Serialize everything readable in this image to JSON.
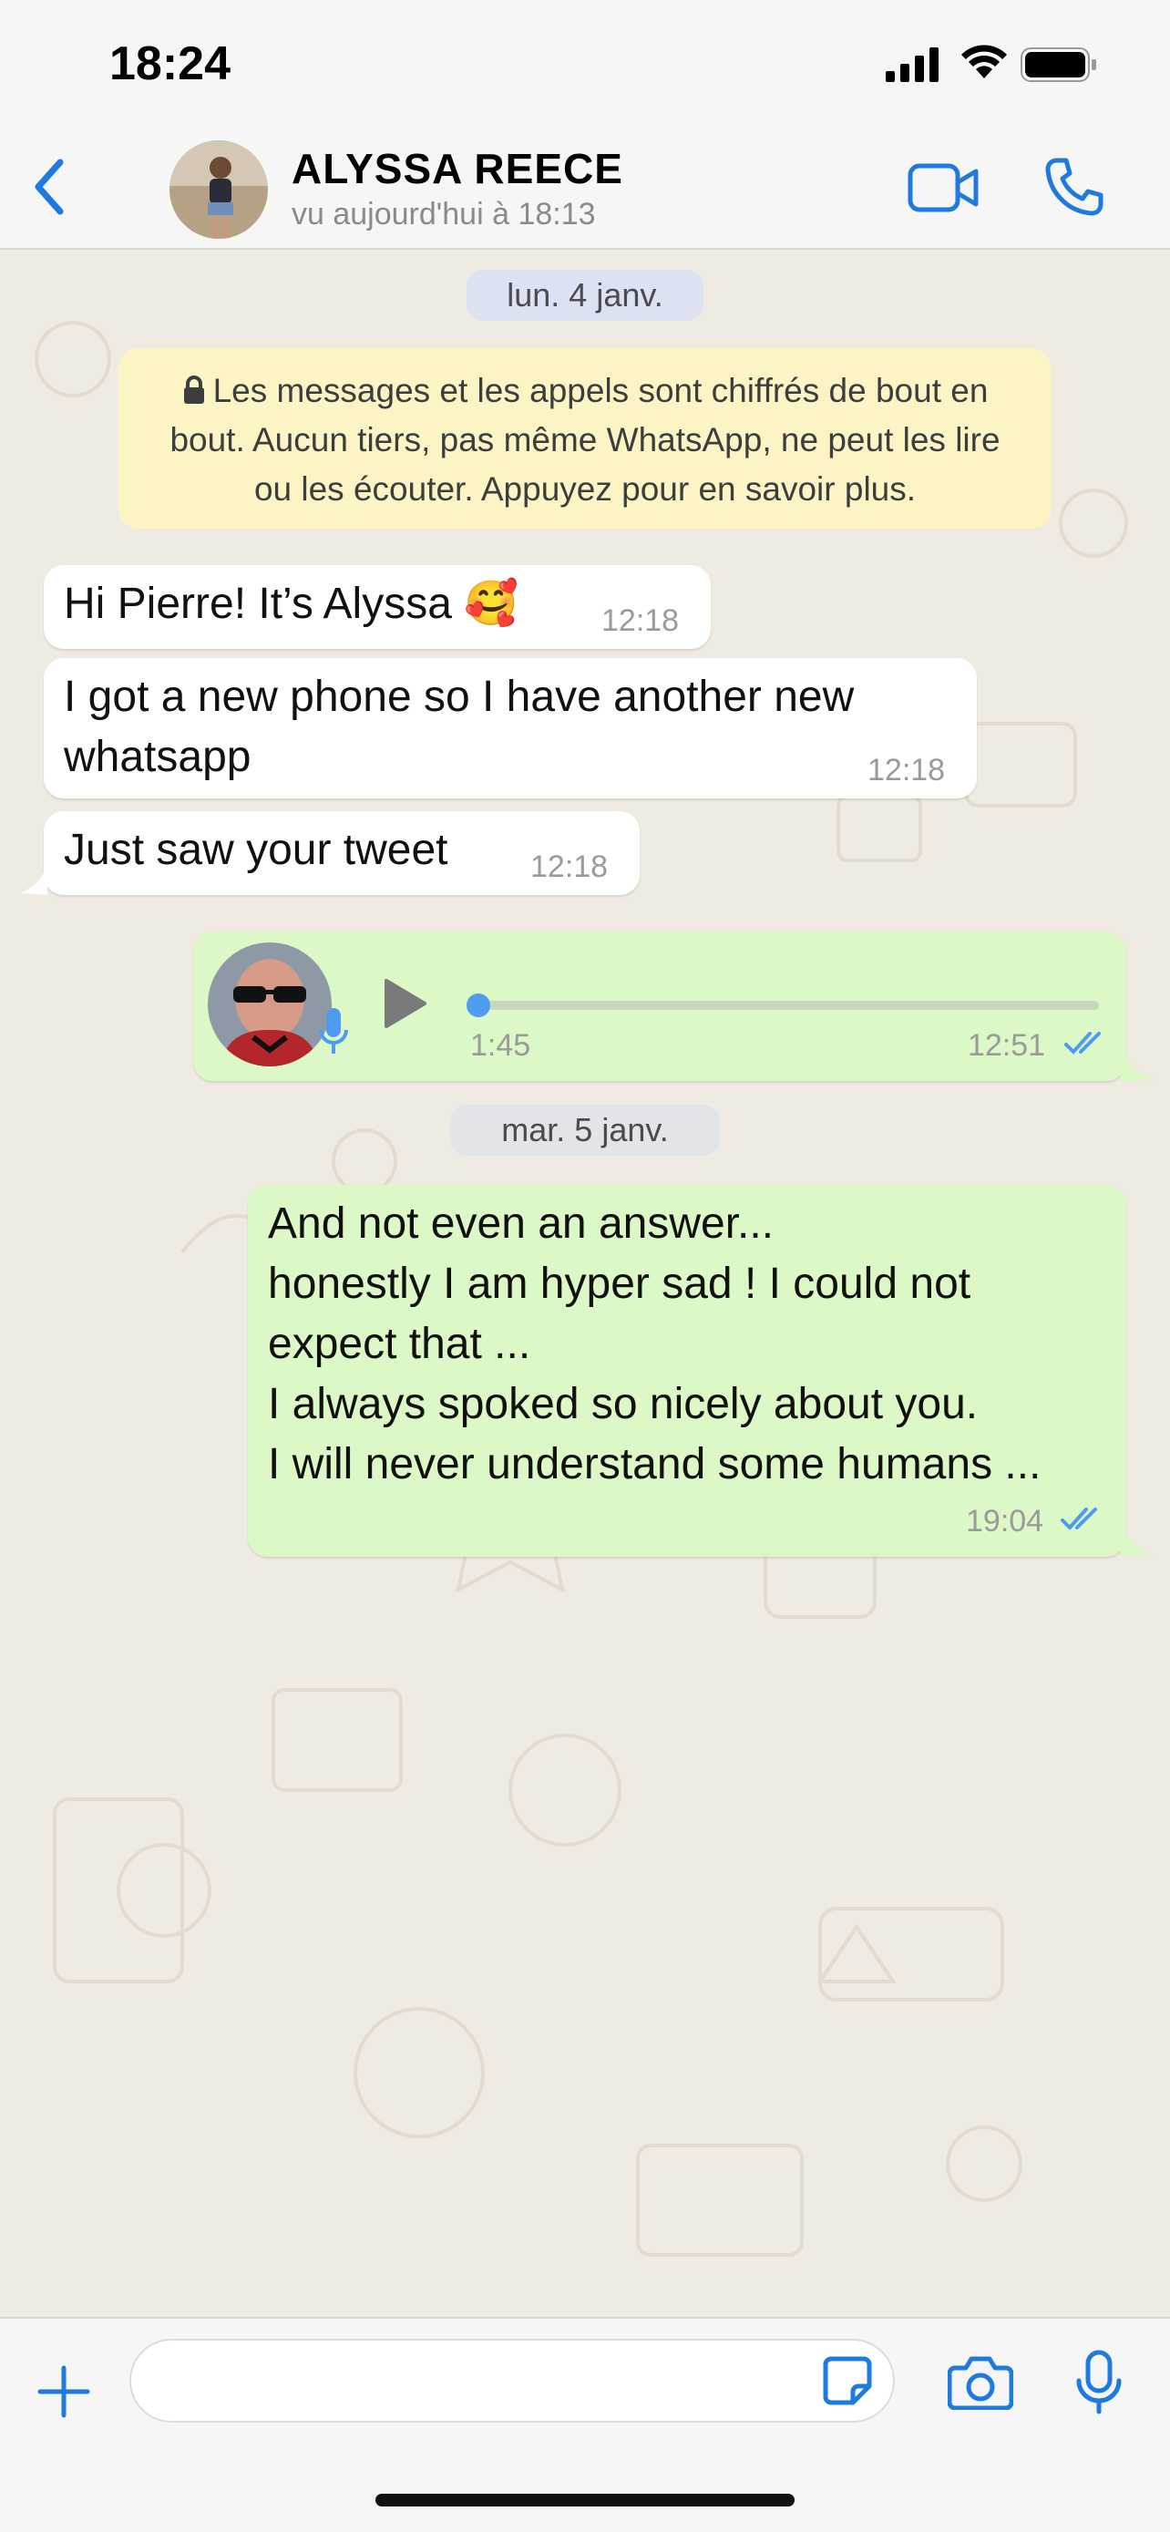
{
  "status_bar": {
    "time": "18:24"
  },
  "header": {
    "contact_name": "ALYSSA REECE",
    "last_seen": "vu aujourd'hui à 18:13"
  },
  "chat": {
    "date_separators": [
      "lun. 4 janv.",
      "mar. 5 janv."
    ],
    "encryption_notice": "Les messages et les appels sont chiffrés de bout en bout. Aucun tiers, pas même WhatsApp, ne peut les lire ou les écouter. Appuyez pour en savoir plus.",
    "messages": [
      {
        "text": "Hi Pierre! It’s Alyssa 🥰",
        "time": "12:18"
      },
      {
        "text": "I got a new phone so I have another new whatsapp",
        "time": "12:18"
      },
      {
        "text": "Just saw your tweet",
        "time": "12:18"
      },
      {
        "type": "voice",
        "duration": "1:45",
        "time": "12:51",
        "progress": 0
      },
      {
        "lines": [
          "And not even an answer...",
          "honestly I am hyper sad ! I could not expect that ...",
          "I always spoked so nicely about you.",
          "I will never understand some humans ..."
        ],
        "time": "19:04"
      }
    ]
  },
  "input": {
    "placeholder": ""
  },
  "colors": {
    "accent": "#1f7ae0",
    "outgoing_bubble": "#dcf8c6",
    "incoming_bubble": "#ffffff",
    "notice": "#fcf4c4",
    "read_ticks": "#4f9bf0"
  }
}
